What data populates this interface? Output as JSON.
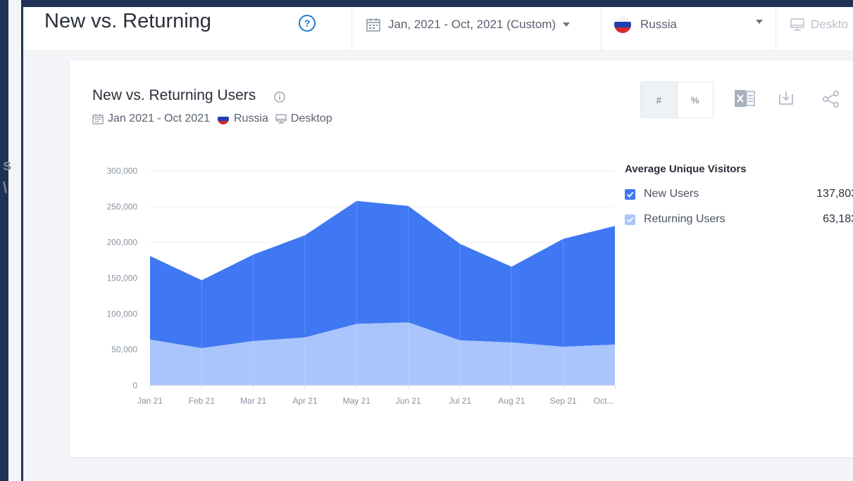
{
  "header": {
    "title": "New vs. Returning",
    "date_range": "Jan, 2021 - Oct, 2021 (Custom)",
    "country": "Russia",
    "device": "Deskto"
  },
  "card": {
    "title": "New vs. Returning Users",
    "subtitle_dates": "Jan 2021 - Oct 2021",
    "subtitle_country": "Russia",
    "subtitle_device": "Desktop",
    "toggle": {
      "absolute": "#",
      "percent": "%",
      "selected": "absolute"
    }
  },
  "legend": {
    "title": "Average Unique Visitors",
    "items": [
      {
        "label": "New Users",
        "value": "137,803",
        "color": "#3f78f2"
      },
      {
        "label": "Returning Users",
        "value": "63,183",
        "color": "#a9c5fb"
      }
    ]
  },
  "colors": {
    "accent": "#1f78d1",
    "new_users": "#3f78f2",
    "returning_users": "#a9c5fb",
    "frame": "#1f3255"
  },
  "icons": [
    "help-icon",
    "calendar-icon",
    "caret-down-icon",
    "flag-russia-icon",
    "desktop-icon",
    "info-icon",
    "excel-icon",
    "download-icon",
    "share-icon",
    "checkbox-icon"
  ],
  "chart_data": {
    "type": "area",
    "stacked": true,
    "categories": [
      "Jan 21",
      "Feb 21",
      "Mar 21",
      "Apr 21",
      "May 21",
      "Jun 21",
      "Jul 21",
      "Aug 21",
      "Sep 21",
      "Oct..."
    ],
    "series": [
      {
        "name": "Returning Users",
        "values": [
          64000,
          52000,
          62000,
          67000,
          86000,
          88000,
          63000,
          60000,
          54000,
          57000
        ]
      },
      {
        "name": "New Users",
        "values": [
          117000,
          95000,
          121000,
          143000,
          172000,
          163000,
          135000,
          106000,
          151000,
          166000
        ]
      }
    ],
    "y_ticks": [
      "0",
      "50,000",
      "100,000",
      "150,000",
      "200,000",
      "250,000",
      "300,000"
    ],
    "ylim": [
      0,
      300000
    ],
    "grid": true,
    "legend_position": "right"
  }
}
